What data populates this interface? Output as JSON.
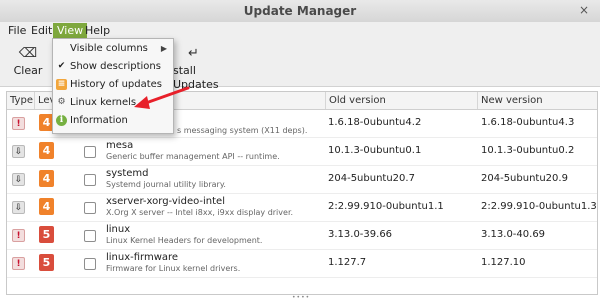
{
  "window": {
    "title": "Update Manager",
    "close_glyph": "×"
  },
  "menubar": {
    "items": [
      "File",
      "Edit",
      "View",
      "Help"
    ],
    "active": "View"
  },
  "toolbar": {
    "buttons": [
      {
        "label": "Clear",
        "icon": "backspace-icon",
        "glyph": "⌫"
      },
      {
        "label": "Install Updates",
        "icon": "enter-icon",
        "glyph": "↵"
      }
    ],
    "install_visible_label": "stall Updates"
  },
  "view_menu": {
    "items": [
      {
        "label": "Visible columns",
        "icon": "none",
        "submenu": true
      },
      {
        "label": "Show descriptions",
        "icon": "check-icon",
        "checked": true
      },
      {
        "label": "History of updates",
        "icon": "history-icon"
      },
      {
        "label": "Linux kernels",
        "icon": "gear-icon"
      },
      {
        "label": "Information",
        "icon": "info-icon"
      }
    ],
    "submenu_glyph": "▶"
  },
  "annotation": {
    "color": "#e8202a"
  },
  "table": {
    "headers": [
      "Type",
      "Leve",
      "",
      "",
      "Old version",
      "New version"
    ],
    "rows": [
      {
        "type": "security",
        "type_glyph": "!",
        "level": "4",
        "level_color": "#f0822b",
        "checked": false,
        "name": "",
        "description": "s messaging system (X11 deps).",
        "old_version": "1.6.18-0ubuntu4.2",
        "new_version": "1.6.18-0ubuntu4.3"
      },
      {
        "type": "update",
        "type_glyph": "⇩",
        "level": "4",
        "level_color": "#f0822b",
        "checked": false,
        "name": "mesa",
        "description": "Generic buffer management API -- runtime.",
        "old_version": "10.1.3-0ubuntu0.1",
        "new_version": "10.1.3-0ubuntu0.2"
      },
      {
        "type": "update",
        "type_glyph": "⇩",
        "level": "4",
        "level_color": "#f0822b",
        "checked": false,
        "name": "systemd",
        "description": "Systemd journal utility library.",
        "old_version": "204-5ubuntu20.7",
        "new_version": "204-5ubuntu20.9"
      },
      {
        "type": "update",
        "type_glyph": "⇩",
        "level": "4",
        "level_color": "#f0822b",
        "checked": false,
        "name": "xserver-xorg-video-intel",
        "description": "X.Org X server -- Intel i8xx, i9xx display driver.",
        "old_version": "2:2.99.910-0ubuntu1.1",
        "new_version": "2:2.99.910-0ubuntu1.3"
      },
      {
        "type": "security",
        "type_glyph": "!",
        "level": "5",
        "level_color": "#d94d3c",
        "checked": false,
        "name": "linux",
        "description": "Linux Kernel Headers for development.",
        "old_version": "3.13.0-39.66",
        "new_version": "3.13.0-40.69"
      },
      {
        "type": "security",
        "type_glyph": "!",
        "level": "5",
        "level_color": "#d94d3c",
        "checked": false,
        "name": "linux-firmware",
        "description": "Firmware for Linux kernel drivers.",
        "old_version": "1.127.7",
        "new_version": "1.127.10"
      }
    ]
  }
}
